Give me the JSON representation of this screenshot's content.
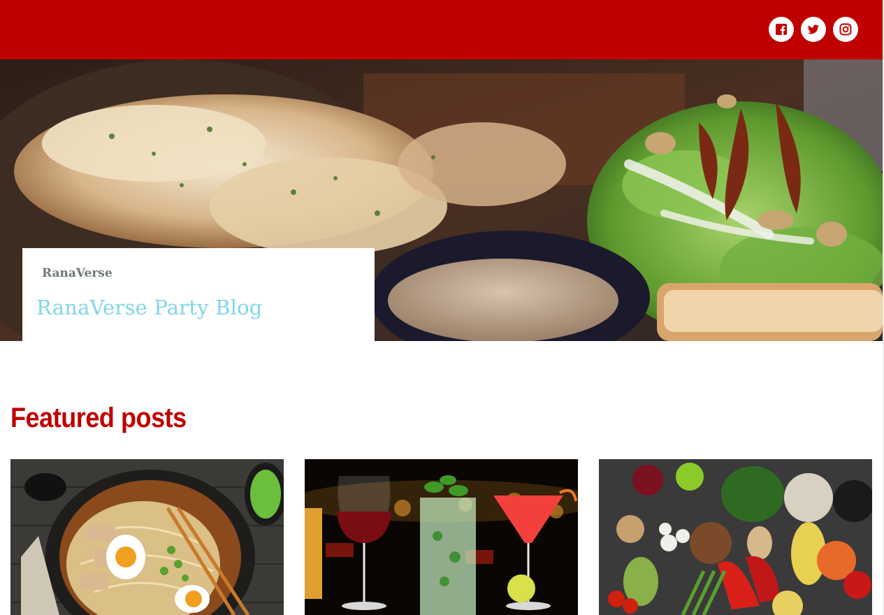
{
  "header": {
    "background_color": "#c00000",
    "social_links": [
      {
        "name": "facebook",
        "icon": "facebook-icon"
      },
      {
        "name": "twitter",
        "icon": "twitter-icon"
      },
      {
        "name": "instagram",
        "icon": "instagram-icon"
      }
    ]
  },
  "hero": {
    "image": "grilled fish with salad and dipping sauce",
    "site_name": "RanaVerse",
    "site_description": "RanaVerse Party Blog"
  },
  "featured": {
    "title": "Featured posts",
    "posts": [
      {
        "image": "ramen bowl with egg and chopsticks"
      },
      {
        "image": "cocktails, wine and beer glasses"
      },
      {
        "image": "assorted vegetables and spices"
      }
    ]
  },
  "colors": {
    "brand_red": "#c00000",
    "site_name": "#6f7a73",
    "tagline": "#7fd7e8"
  }
}
